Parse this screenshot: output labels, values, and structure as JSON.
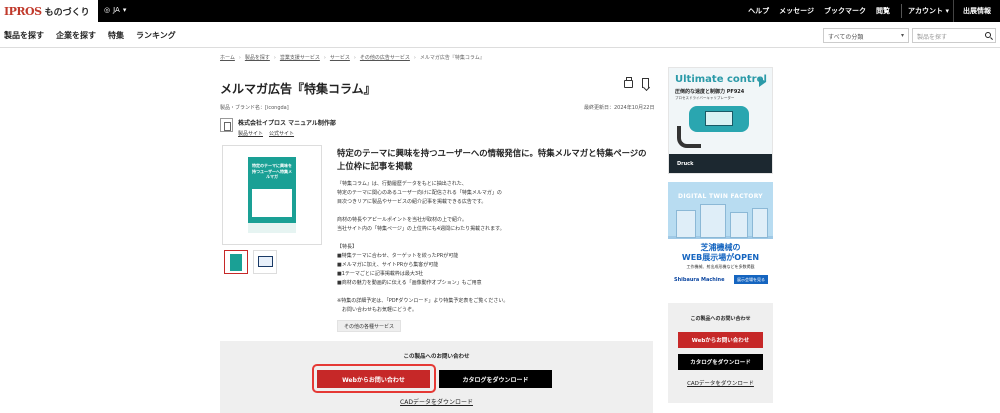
{
  "header": {
    "logo": "IPROS",
    "logo_sub": "ものづくり",
    "lang": "JA",
    "links": [
      "ヘルプ",
      "メッセージ",
      "ブックマーク",
      "閲覧"
    ],
    "account": "アカウント",
    "register": "出展情報"
  },
  "nav": {
    "items": [
      "製品を探す",
      "企業を探す",
      "特集",
      "ランキング"
    ],
    "category_select": "すべての分類",
    "search_placeholder": "製品を探す"
  },
  "breadcrumb": [
    "ホーム",
    "製品を探す",
    "営業支援サービス",
    "サービス",
    "その他の広告サービス",
    "メルマガ広告『特集コラム』"
  ],
  "product": {
    "title": "メルマガ広告『特集コラム』",
    "brand": "製品・ブランド名：[icongda]",
    "updated": "最終更新日：2024年10月22日",
    "company": "株式会社イプロス マニュアル制作部",
    "company_links": [
      "製品サイト",
      "公式サイト"
    ],
    "poster_text": "特定のテーマに興味を持つユーザーへ特集メルマガ"
  },
  "description": {
    "headline": "特定のテーマに興味を持つユーザーへの情報発信に。特集メルマガと特集ページの上位枠に記事を掲載",
    "lines": [
      "『特集コラム』は、行動履歴データをもとに抽出された、",
      "特定のテーマに関心のあるユーザー向けに配信される「特集メルマガ」の",
      "目次つきリアに製品やサービスの紹介記事を掲載できる広告です。",
      "",
      "商材の特長やアピールポイントを当社が取材の上で紹介。",
      "当社サイト内の「特集ページ」の上位枠にも4週間にわたり掲載されます。",
      "",
      "【特長】",
      "■特集テーマに合わせ、ターゲットを絞ったPRが可能",
      "■メルマガに加え、サイトPRから集客が可能",
      "■1テーマごとに記事掲載枠は最大3社",
      "■商材の魅力を動画的に伝える「画像動作オプション」もご用意",
      "",
      "※特集の詳細予定は、「PDFダウンロード」より特集予定表をご覧ください。",
      "　お問い合わせもお気軽にどうぞ。"
    ],
    "other_services": "その他の各種サービス"
  },
  "contact": {
    "title": "この製品へのお問い合わせ",
    "web_button": "Webからお問い合わせ",
    "catalog_button": "カタログをダウンロード",
    "cad_link": "CADデータをダウンロード"
  },
  "ads": {
    "ad1": {
      "title": "Ultimate control",
      "sub": "圧倒的な速度と制御力 PF924",
      "small": "プロセスドライバーキャリブレーター",
      "footer": "Druck"
    },
    "ad2": {
      "top": "DIGITAL TWIN FACTORY",
      "line1": "芝浦機械の",
      "line2": "WEB展示場がOPEN",
      "line3": "工作機械、射出成形機などを多数掲載",
      "brand": "Shibaura Machine",
      "enter": "展示会場を見る"
    }
  },
  "sidebar_contact": {
    "title": "この製品へのお問い合わせ",
    "web_button": "Webからお問い合わせ",
    "catalog_button": "カタログをダウンロード",
    "cad_link": "CADデータをダウンロード"
  },
  "colors": {
    "primary_red": "#c62828",
    "highlight": "#e53935",
    "teal": "#1aa095"
  }
}
